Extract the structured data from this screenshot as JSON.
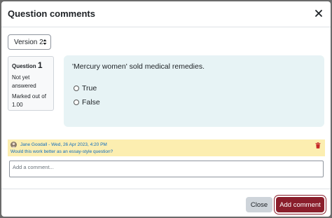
{
  "dialog": {
    "title": "Question comments",
    "close_icon": "close-icon"
  },
  "version_select": {
    "value": "Version 2",
    "icon": "up-down-chevron-icon"
  },
  "question_info": {
    "label": "Question",
    "number": "1",
    "state": "Not yet answered",
    "grade": "Marked out of 1.00"
  },
  "question": {
    "text": "'Mercury women' sold medical remedies.",
    "options": [
      "True",
      "False"
    ]
  },
  "comment": {
    "author": "Jane Goodall",
    "date": "Wed, 26 Apr 2023, 4:20 PM",
    "meta": "Jane Goodall - Wed, 26 Apr 2023, 4:20 PM",
    "text": "Would this work better as an essay-style question?",
    "delete_icon": "trash-icon",
    "highlight_color": "#fceeb0",
    "link_color": "#0f6cbf"
  },
  "new_comment": {
    "placeholder": "Add a comment..."
  },
  "footer": {
    "close_label": "Close",
    "add_label": "Add comment",
    "primary_color": "#8a1e2b"
  }
}
